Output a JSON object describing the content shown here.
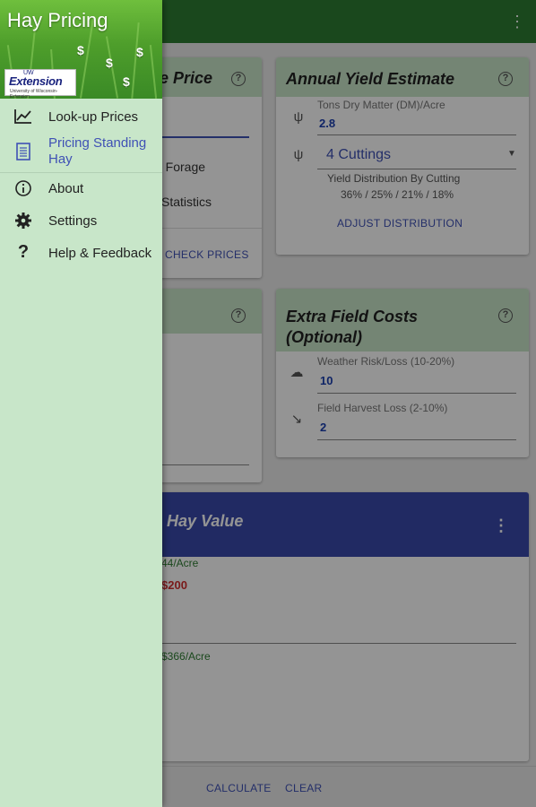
{
  "drawer": {
    "title": "Hay Pricing",
    "logo_top": "UW",
    "logo_main": "Extension",
    "logo_sub": "University of Wisconsin-Extension",
    "items": [
      {
        "label": "Look-up Prices",
        "icon": "chart-line-icon",
        "active": false
      },
      {
        "label": "Pricing Standing\nHay",
        "icon": "document-icon",
        "active": true
      },
      {
        "label": "About",
        "icon": "info-icon",
        "active": false
      },
      {
        "label": "Settings",
        "icon": "gear-icon",
        "active": false
      },
      {
        "label": "Help & Feedback",
        "icon": "question-icon",
        "active": false
      }
    ]
  },
  "price_card": {
    "title_fragment": "e Price",
    "line1": "n Forage",
    "line2": "Statistics",
    "check_prices": "CHECK PRICES"
  },
  "yield_card": {
    "title": "Annual Yield Estimate",
    "dm_label": "Tons Dry Matter (DM)/Acre",
    "dm_value": "2.8",
    "cuttings": "4 Cuttings",
    "distribution_label": "Yield Distribution By Cutting",
    "distribution_values": "36% / 25% / 21% / 18%",
    "adjust": "ADJUST DISTRIBUTION"
  },
  "costs_card": {
    "title": "Extra Field Costs\n(Optional)",
    "weather_label": "Weather Risk/Loss (10-20%)",
    "weather_value": "10",
    "harvest_label": "Field Harvest Loss (2-10%)",
    "harvest_value": "2"
  },
  "value_card": {
    "title_fragment": "Hay Value",
    "row1": "44/Acre",
    "row2": "$200",
    "row3": "$366/Acre"
  },
  "bottom": {
    "calculate": "CALCULATE",
    "clear": "CLEAR"
  },
  "colors": {
    "appbar": "#2e7d32",
    "drawer_bg": "#c8e6c9",
    "accent_blue": "#3f51b5",
    "value_header": "#3949ab",
    "negative_red": "#d32f2f",
    "positive_green": "#2e7d32"
  }
}
